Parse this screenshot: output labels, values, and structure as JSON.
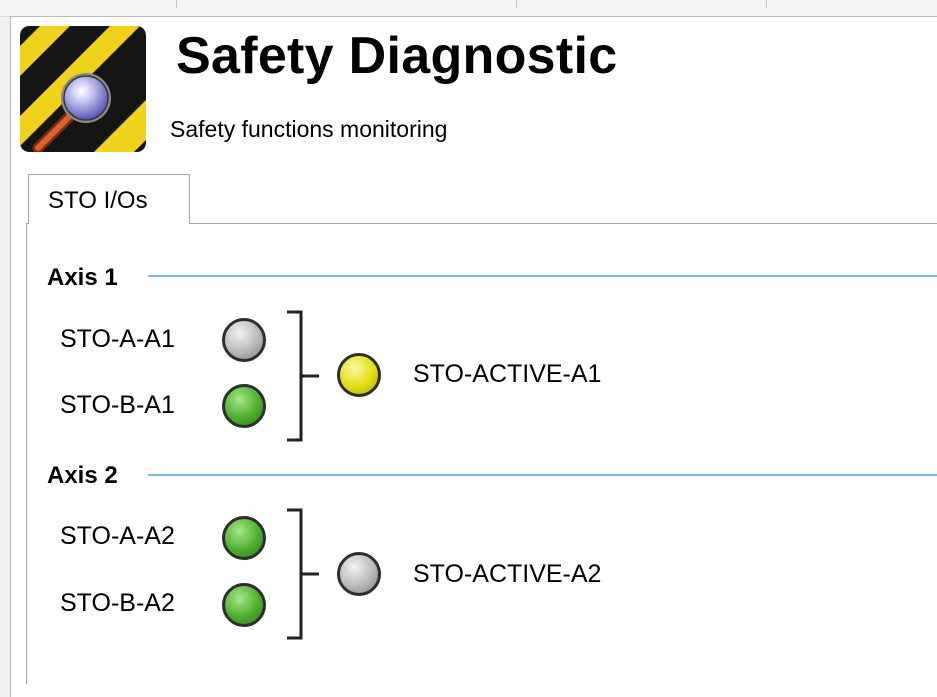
{
  "header": {
    "title": "Safety Diagnostic",
    "subtitle": "Safety functions monitoring",
    "logo_icon": "magnifier-hazard-stripes-icon"
  },
  "tabs": [
    {
      "label": "STO I/Os",
      "selected": true
    }
  ],
  "axes": [
    {
      "title": "Axis 1",
      "inputs": [
        {
          "label": "STO-A-A1",
          "state": "gray"
        },
        {
          "label": "STO-B-A1",
          "state": "green"
        }
      ],
      "output": {
        "label": "STO-ACTIVE-A1",
        "state": "yellow"
      }
    },
    {
      "title": "Axis 2",
      "inputs": [
        {
          "label": "STO-A-A2",
          "state": "green"
        },
        {
          "label": "STO-B-A2",
          "state": "green"
        }
      ],
      "output": {
        "label": "STO-ACTIVE-A2",
        "state": "gray"
      }
    }
  ],
  "colors": {
    "section_line": "#7fb8ec",
    "led_gray": "#b9b9b9",
    "led_green": "#4ead2d",
    "led_yellow": "#e2dd10",
    "logo_stripe_yellow": "#f1d21a",
    "logo_stripe_black": "#151515"
  }
}
